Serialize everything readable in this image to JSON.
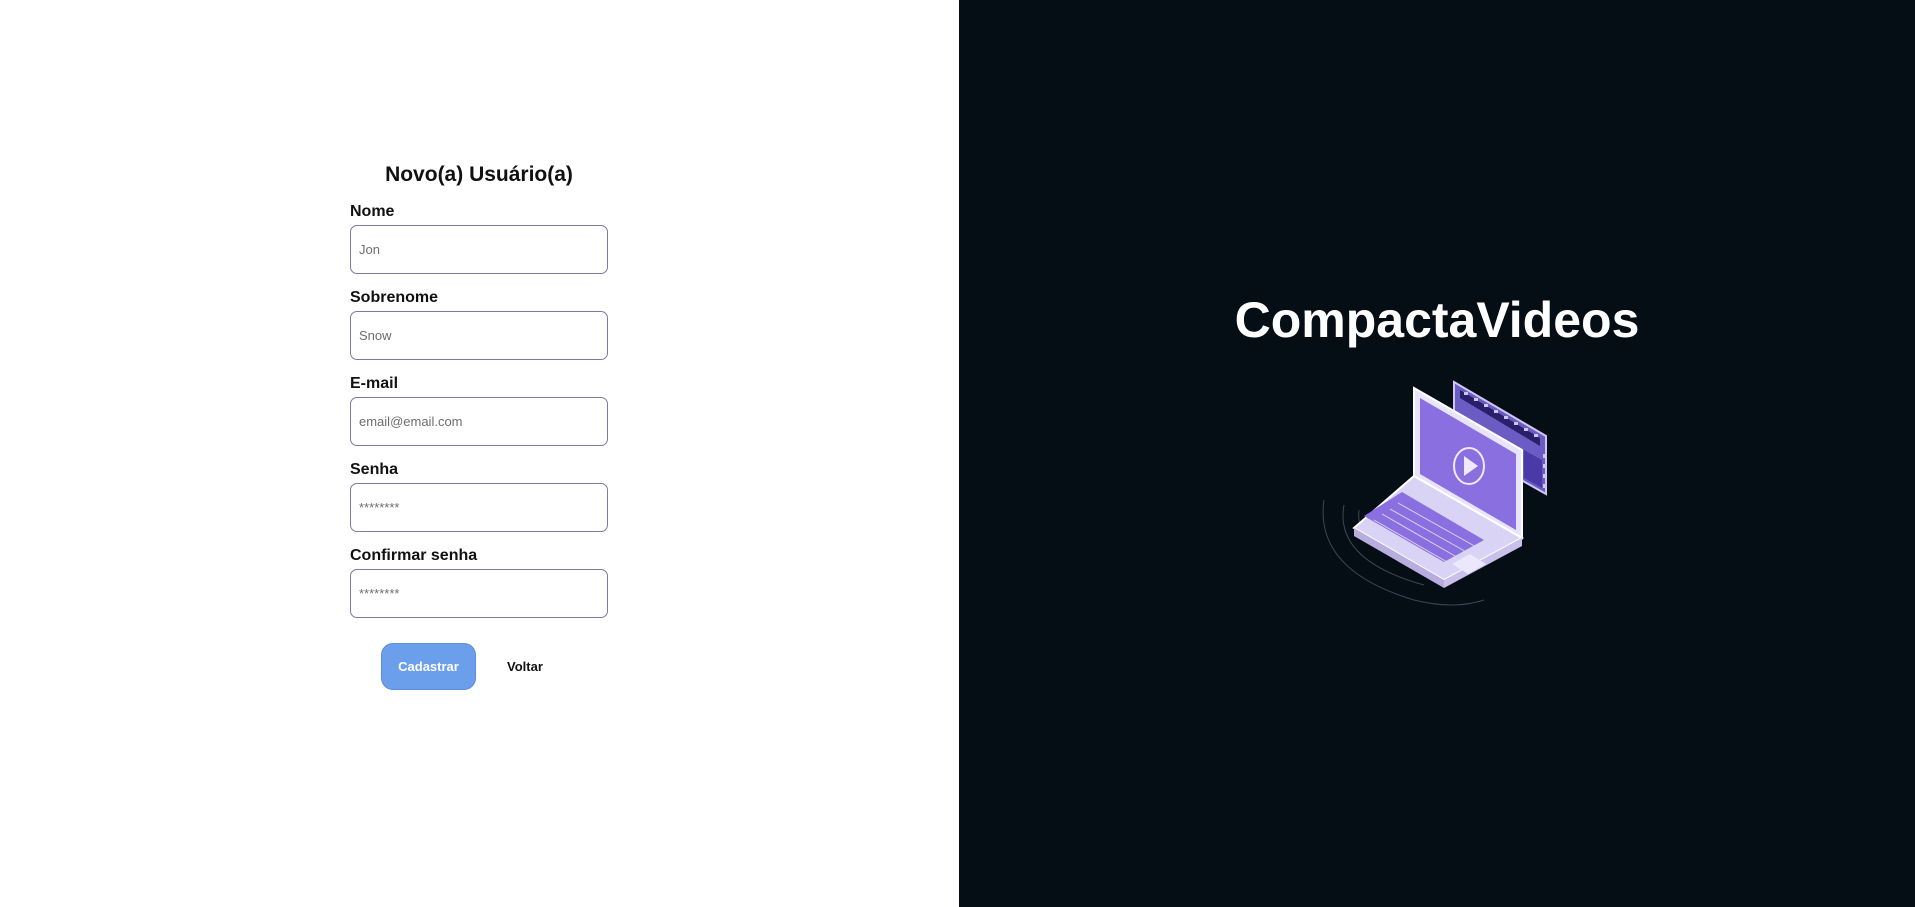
{
  "form": {
    "title": "Novo(a) Usuário(a)",
    "fields": [
      {
        "label": "Nome",
        "placeholder": "Jon",
        "type": "text"
      },
      {
        "label": "Sobrenome",
        "placeholder": "Snow",
        "type": "text"
      },
      {
        "label": "E-mail",
        "placeholder": "email@email.com",
        "type": "email"
      },
      {
        "label": "Senha",
        "placeholder": "********",
        "type": "password"
      },
      {
        "label": "Confirmar senha",
        "placeholder": "********",
        "type": "password"
      }
    ],
    "submit_label": "Cadastrar",
    "back_label": "Voltar"
  },
  "brand": {
    "title": "CompactaVideos",
    "illustration_icon": "laptop-video-icon"
  },
  "colors": {
    "left_background": "#ffffff",
    "right_background": "#050e15",
    "primary_button": "#6b9fec",
    "input_border": "#7b7ba0",
    "illustration_accent": "#8a6fe0"
  }
}
